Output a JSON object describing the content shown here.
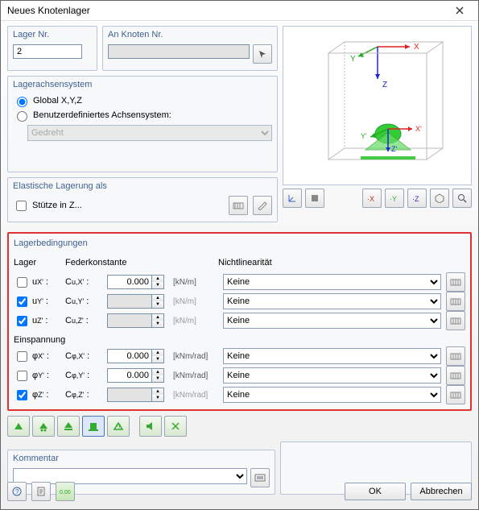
{
  "title": "Neues Knotenlager",
  "top": {
    "lagerNrLabel": "Lager Nr.",
    "lagerNr": "2",
    "anKnotenLabel": "An Knoten Nr."
  },
  "axis": {
    "title": "Lagerachsensystem",
    "global": "Global X,Y,Z",
    "user": "Benutzerdefiniertes Achsensystem:",
    "typeValue": "Gedreht"
  },
  "elastic": {
    "title": "Elastische Lagerung als",
    "columnZ": "Stütze in Z..."
  },
  "cond": {
    "title": "Lagerbedingungen",
    "hLager": "Lager",
    "hFeder": "Federkonstante",
    "hNonlin": "Nichtlinearität",
    "hEinsp": "Einspannung",
    "support": [
      {
        "id": "ux",
        "label": "u",
        "sub": "X'",
        "checked": false,
        "constLabel": "C",
        "constSub": "u,X'",
        "value": "0.000",
        "unit": "[kN/m]",
        "enabled": true,
        "nl": "Keine"
      },
      {
        "id": "uy",
        "label": "u",
        "sub": "Y'",
        "checked": true,
        "constLabel": "C",
        "constSub": "u,Y'",
        "value": "",
        "unit": "[kN/m]",
        "enabled": false,
        "nl": "Keine"
      },
      {
        "id": "uz",
        "label": "u",
        "sub": "Z'",
        "checked": true,
        "constLabel": "C",
        "constSub": "u,Z'",
        "value": "",
        "unit": "[kN/m]",
        "enabled": false,
        "nl": "Keine"
      }
    ],
    "restraint": [
      {
        "id": "phix",
        "label": "φ",
        "sub": "X'",
        "checked": false,
        "constLabel": "C",
        "constSub": "φ,X'",
        "value": "0.000",
        "unit": "[kNm/rad]",
        "enabled": true,
        "nl": "Keine"
      },
      {
        "id": "phiy",
        "label": "φ",
        "sub": "Y'",
        "checked": false,
        "constLabel": "C",
        "constSub": "φ,Y'",
        "value": "0.000",
        "unit": "[kNm/rad]",
        "enabled": true,
        "nl": "Keine"
      },
      {
        "id": "phiz",
        "label": "φ",
        "sub": "Z'",
        "checked": true,
        "constLabel": "C",
        "constSub": "φ,Z'",
        "value": "",
        "unit": "[kNm/rad]",
        "enabled": false,
        "nl": "Keine"
      }
    ]
  },
  "comment": {
    "title": "Kommentar"
  },
  "footer": {
    "ok": "OK",
    "cancel": "Abbrechen"
  }
}
